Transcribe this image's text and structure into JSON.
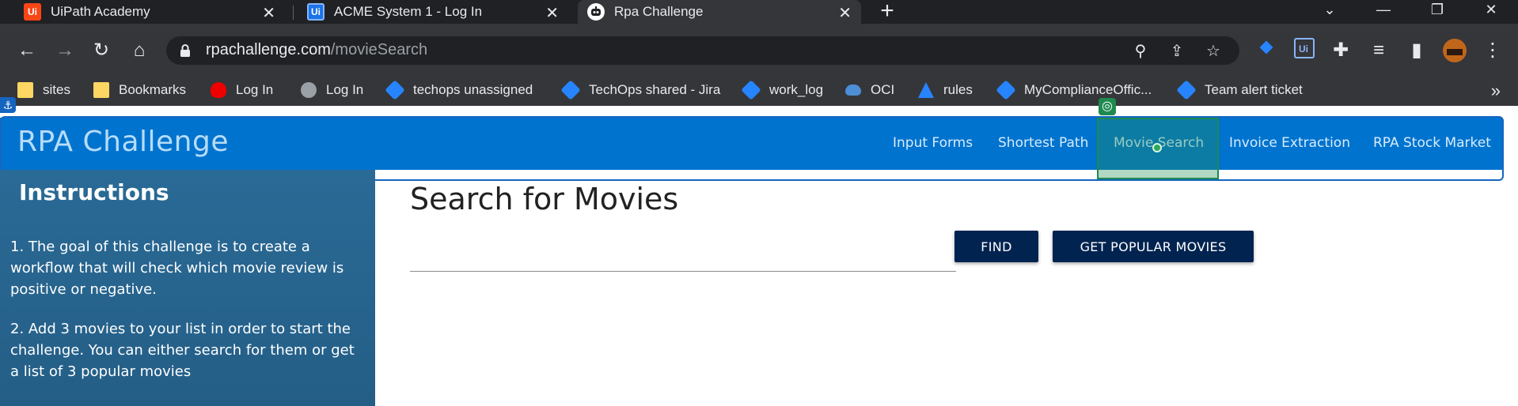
{
  "browser": {
    "tabs": [
      {
        "title": "UiPath Academy",
        "favicon": "Ui",
        "state": "inactive"
      },
      {
        "title": "ACME System 1 - Log In",
        "favicon": "Ui",
        "state": "inactive"
      },
      {
        "title": "Rpa Challenge",
        "favicon": "robot-icon",
        "state": "active"
      }
    ],
    "new_tab": "+",
    "url_host": "rpachallenge.com",
    "url_path": "/movieSearch",
    "bookmarks": [
      {
        "label": "sites",
        "icon": "folder-icon"
      },
      {
        "label": "Bookmarks",
        "icon": "folder-icon"
      },
      {
        "label": "Log In",
        "icon": "redhat-icon"
      },
      {
        "label": "Log In",
        "icon": "globe-icon"
      },
      {
        "label": "techops unassigned",
        "icon": "jira-icon"
      },
      {
        "label": "TechOps shared - Jira",
        "icon": "jira-icon"
      },
      {
        "label": "work_log",
        "icon": "jira-icon"
      },
      {
        "label": "OCI",
        "icon": "cloud-icon"
      },
      {
        "label": "rules",
        "icon": "atlassian-icon"
      },
      {
        "label": "MyComplianceOffic...",
        "icon": "jira-icon"
      },
      {
        "label": "Team alert ticket",
        "icon": "jira-icon"
      }
    ],
    "more_bookmarks": "»"
  },
  "site": {
    "brand": "RPA Challenge",
    "nav": [
      "Input Forms",
      "Shortest Path",
      "Movie Search",
      "Invoice Extraction",
      "RPA Stock Market"
    ],
    "colors": {
      "header": "#0073cf",
      "button": "#002350",
      "sidebar": "#2a6a96"
    }
  },
  "sidebar": {
    "heading": "Instructions",
    "paragraphs": [
      "1. The goal of this challenge is to create a workflow that will check which movie review is positive or negative.",
      "2. Add 3 movies to your list in order to start the challenge. You can either search for them or get a list of 3 popular movies"
    ]
  },
  "main": {
    "title": "Search for Movies",
    "search_value": "",
    "find_label": "FIND",
    "popular_label": "GET POPULAR MOVIES"
  }
}
